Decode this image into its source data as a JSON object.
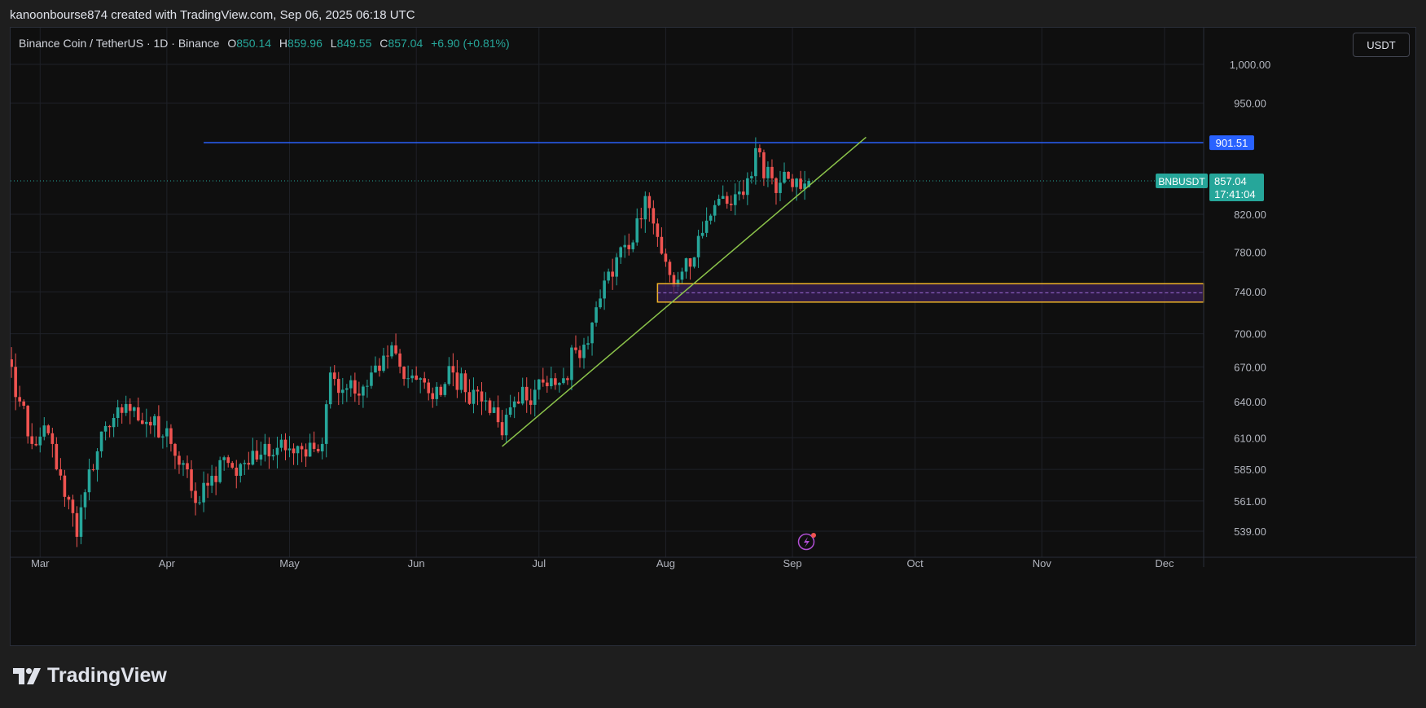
{
  "header": {
    "text": "kanoonbourse874 created with TradingView.com, Sep 06, 2025 06:18 UTC"
  },
  "legend": {
    "symbol": "Binance Coin / TetherUS · 1D · Binance",
    "o_label": "O",
    "o_value": "850.14",
    "h_label": "H",
    "h_value": "859.96",
    "l_label": "L",
    "l_value": "849.55",
    "c_label": "C",
    "c_value": "857.04",
    "change": "+6.90 (+0.81%)"
  },
  "currency_button": "USDT",
  "branding": {
    "name": "TradingView",
    "icon": "tradingview-logo-icon"
  },
  "colors": {
    "up": "#26a69a",
    "down": "#ef5350",
    "resistance": "#2962ff",
    "trendline": "#8bc34a",
    "zone_border": "#f0b429",
    "zone_fill": "#3a1f5a"
  },
  "chart_data": {
    "type": "candlestick",
    "symbol": "BNBUSDT",
    "interval": "1D",
    "y_axis": {
      "scale": "log",
      "ticks": [
        "539.00",
        "561.00",
        "585.00",
        "610.00",
        "640.00",
        "670.00",
        "700.00",
        "740.00",
        "780.00",
        "820.00",
        "950.00",
        "1,000.00"
      ],
      "position": "right"
    },
    "x_axis": {
      "ticks": [
        "Mar",
        "Apr",
        "May",
        "Jun",
        "Jul",
        "Aug",
        "Sep",
        "Oct",
        "Nov",
        "Dec"
      ]
    },
    "grid": true,
    "anchors": [
      [
        "2025-02-22",
        670
      ],
      [
        "2025-02-24",
        640
      ],
      [
        "2025-02-27",
        605
      ],
      [
        "2025-03-02",
        620
      ],
      [
        "2025-03-05",
        585
      ],
      [
        "2025-03-08",
        562
      ],
      [
        "2025-03-10",
        535
      ],
      [
        "2025-03-13",
        585
      ],
      [
        "2025-03-16",
        615
      ],
      [
        "2025-03-20",
        635
      ],
      [
        "2025-03-24",
        635
      ],
      [
        "2025-03-28",
        620
      ],
      [
        "2025-04-02",
        605
      ],
      [
        "2025-04-06",
        585
      ],
      [
        "2025-04-09",
        560
      ],
      [
        "2025-04-12",
        580
      ],
      [
        "2025-04-16",
        590
      ],
      [
        "2025-04-20",
        590
      ],
      [
        "2025-04-25",
        605
      ],
      [
        "2025-04-30",
        600
      ],
      [
        "2025-05-05",
        595
      ],
      [
        "2025-05-09",
        605
      ],
      [
        "2025-05-11",
        665
      ],
      [
        "2025-05-14",
        650
      ],
      [
        "2025-05-18",
        645
      ],
      [
        "2025-05-21",
        665
      ],
      [
        "2025-05-24",
        680
      ],
      [
        "2025-05-27",
        682
      ],
      [
        "2025-05-30",
        660
      ],
      [
        "2025-06-02",
        660
      ],
      [
        "2025-06-05",
        642
      ],
      [
        "2025-06-08",
        655
      ],
      [
        "2025-06-10",
        665
      ],
      [
        "2025-06-13",
        648
      ],
      [
        "2025-06-17",
        640
      ],
      [
        "2025-06-20",
        635
      ],
      [
        "2025-06-22",
        612
      ],
      [
        "2025-06-25",
        640
      ],
      [
        "2025-06-30",
        650
      ],
      [
        "2025-07-04",
        660
      ],
      [
        "2025-07-07",
        660
      ],
      [
        "2025-07-10",
        685
      ],
      [
        "2025-07-12",
        690
      ],
      [
        "2025-07-15",
        725
      ],
      [
        "2025-07-18",
        760
      ],
      [
        "2025-07-21",
        785
      ],
      [
        "2025-07-24",
        790
      ],
      [
        "2025-07-27",
        840
      ],
      [
        "2025-07-29",
        810
      ],
      [
        "2025-08-01",
        770
      ],
      [
        "2025-08-03",
        745
      ],
      [
        "2025-08-05",
        760
      ],
      [
        "2025-08-07",
        765
      ],
      [
        "2025-08-10",
        800
      ],
      [
        "2025-08-13",
        830
      ],
      [
        "2025-08-15",
        840
      ],
      [
        "2025-08-17",
        830
      ],
      [
        "2025-08-19",
        845
      ],
      [
        "2025-08-21",
        860
      ],
      [
        "2025-08-23",
        895
      ],
      [
        "2025-08-25",
        860
      ],
      [
        "2025-08-27",
        860
      ],
      [
        "2025-08-29",
        855
      ],
      [
        "2025-09-01",
        850
      ],
      [
        "2025-09-03",
        848
      ],
      [
        "2025-09-05",
        857.04
      ]
    ],
    "levels": [
      {
        "name": "resistance",
        "value": 901.51,
        "label": "901.51",
        "from": "2025-04-10"
      }
    ],
    "zone": {
      "low": 730,
      "high": 748,
      "mid": 739,
      "from": "2025-07-30"
    },
    "trendline": {
      "from": [
        "2025-06-22",
        603
      ],
      "to": [
        "2025-09-19",
        908
      ]
    },
    "last_price": {
      "label": "BNBUSDT",
      "value": "857.04",
      "countdown": "17:41:04"
    }
  }
}
